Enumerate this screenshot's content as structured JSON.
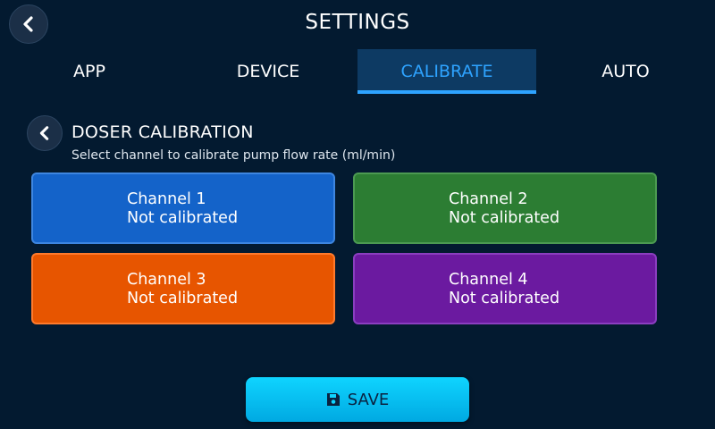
{
  "header": {
    "title": "SETTINGS",
    "back_icon": "chevron-left-icon"
  },
  "tabs": [
    {
      "label": "APP",
      "active": false
    },
    {
      "label": "DEVICE",
      "active": false
    },
    {
      "label": "CALIBRATE",
      "active": true
    },
    {
      "label": "AUTO",
      "active": false
    }
  ],
  "section": {
    "title": "DOSER CALIBRATION",
    "subtitle": "Select channel to calibrate pump flow rate (ml/min)",
    "back_icon": "chevron-left-icon"
  },
  "channels": [
    {
      "name": "Channel 1",
      "status": "Not calibrated",
      "color": "#1463c9"
    },
    {
      "name": "Channel 2",
      "status": "Not calibrated",
      "color": "#2c7d33"
    },
    {
      "name": "Channel 3",
      "status": "Not calibrated",
      "color": "#e75500"
    },
    {
      "name": "Channel 4",
      "status": "Not calibrated",
      "color": "#6b1aa0"
    }
  ],
  "footer": {
    "save_label": "SAVE",
    "save_icon": "floppy-disk-icon",
    "save_color": "#0fd4ff"
  },
  "colors": {
    "background": "#031a30",
    "accent": "#2ea3ff"
  }
}
